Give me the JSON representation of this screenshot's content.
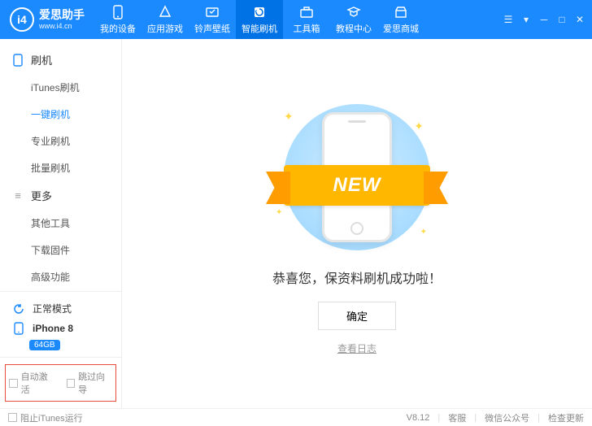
{
  "logo": {
    "badge": "i4",
    "cn": "爱思助手",
    "url": "www.i4.cn"
  },
  "nav": [
    {
      "label": "我的设备",
      "icon": "phone"
    },
    {
      "label": "应用游戏",
      "icon": "apps"
    },
    {
      "label": "铃声壁纸",
      "icon": "ringtone"
    },
    {
      "label": "智能刷机",
      "icon": "flash"
    },
    {
      "label": "工具箱",
      "icon": "toolbox"
    },
    {
      "label": "教程中心",
      "icon": "tutorial"
    },
    {
      "label": "爱思商城",
      "icon": "store"
    }
  ],
  "sidebar": {
    "group1": {
      "title": "刷机",
      "items": [
        "iTunes刷机",
        "一键刷机",
        "专业刷机",
        "批量刷机"
      ]
    },
    "group2": {
      "title": "更多",
      "items": [
        "其他工具",
        "下载固件",
        "高级功能"
      ]
    }
  },
  "status": {
    "mode": "正常模式",
    "device": "iPhone 8",
    "storage": "64GB"
  },
  "bottom_checks": {
    "auto_activate": "自动激活",
    "skip_guide": "跳过向导"
  },
  "main": {
    "ribbon": "NEW",
    "message": "恭喜您，保资料刷机成功啦！",
    "ok": "确定",
    "log": "查看日志"
  },
  "footer": {
    "block_itunes": "阻止iTunes运行",
    "version": "V8.12",
    "support": "客服",
    "wechat": "微信公众号",
    "update": "检查更新"
  }
}
